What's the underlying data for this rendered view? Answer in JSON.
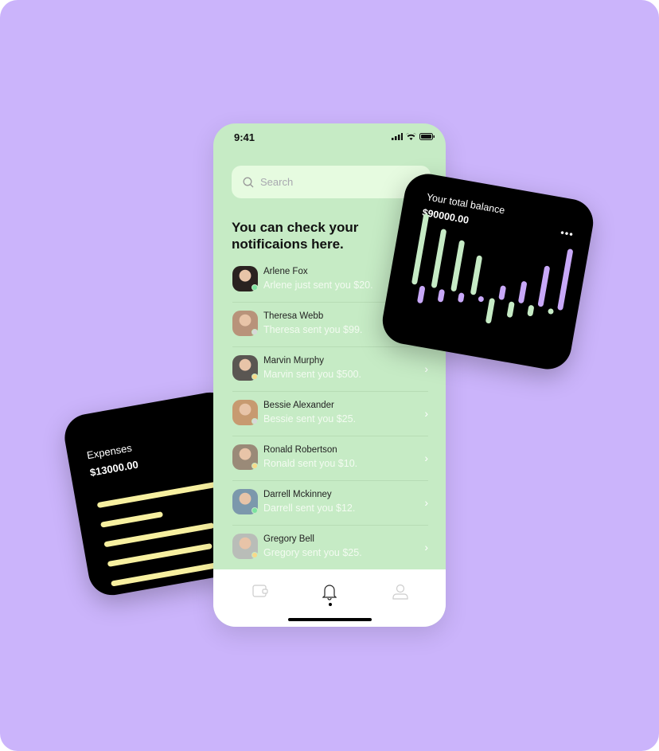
{
  "expenses_card": {
    "title": "Expenses",
    "amount": "$13000.00",
    "bar_fractions": [
      1.0,
      0.45,
      0.8,
      0.76,
      0.78
    ],
    "bar_color": "#f7f0a0"
  },
  "phone": {
    "status": {
      "time": "9:41",
      "icons": [
        "signal-icon",
        "wifi-icon",
        "battery-icon"
      ]
    },
    "search": {
      "placeholder": "Search"
    },
    "heading": "You can check your notificaions here.",
    "notifications": [
      {
        "name": "Arlene Fox",
        "message": "Arlene just sent you $20.",
        "status_color": "#7de3a0",
        "avatar_color": "#2a2220"
      },
      {
        "name": "Theresa Webb",
        "message": "Theresa sent you $99.",
        "status_color": "#d8d8d8",
        "avatar_color": "#b8937a"
      },
      {
        "name": "Marvin Murphy",
        "message": "Marvin sent you $500.",
        "status_color": "#f7d98a",
        "avatar_color": "#5a5652"
      },
      {
        "name": "Bessie Alexander",
        "message": "Bessie sent you $25.",
        "status_color": "#d8d8d8",
        "avatar_color": "#c79a70"
      },
      {
        "name": "Ronald Robertson",
        "message": "Ronald sent you $10.",
        "status_color": "#f7d98a",
        "avatar_color": "#9a8a78"
      },
      {
        "name": "Darrell Mckinney",
        "message": "Darrell sent you $12.",
        "status_color": "#7de3a0",
        "avatar_color": "#7c98ac"
      },
      {
        "name": "Gregory Bell",
        "message": "Gregory sent you $25.",
        "status_color": "#f7d98a",
        "avatar_color": "#b9bdb8"
      }
    ],
    "nav": [
      {
        "icon": "wallet-icon",
        "active": false
      },
      {
        "icon": "bell-icon",
        "active": true
      },
      {
        "icon": "user-icon",
        "active": false
      }
    ]
  },
  "balance_card": {
    "title": "Your total balance",
    "amount": "$90000.00",
    "menu": "•••"
  },
  "chart_data": {
    "type": "bar",
    "green": [
      90,
      75,
      65,
      50,
      -32,
      -20,
      -14,
      -3
    ],
    "purple": [
      -22,
      -16,
      -12,
      -4,
      18,
      28,
      52,
      78
    ],
    "colors": {
      "green": "#c6ebc5",
      "purple": "#c8a8f8"
    }
  },
  "colors": {
    "background": "#cbb4fb",
    "phone": "#c6ebc5",
    "card": "#000000"
  }
}
